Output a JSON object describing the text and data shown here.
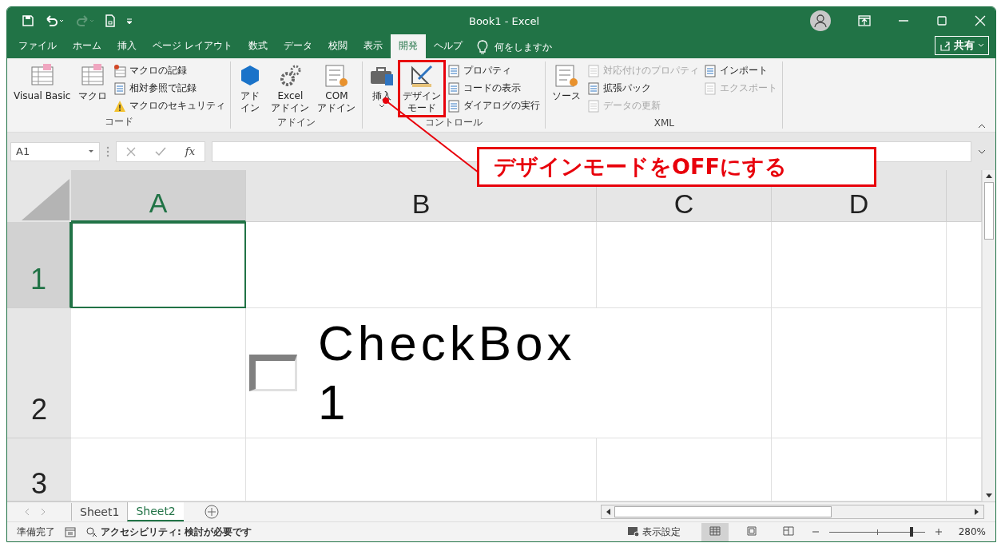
{
  "window": {
    "title": "Book1  -  Excel"
  },
  "share_button": {
    "label": "共有"
  },
  "tabs": [
    {
      "label": "ファイル",
      "selected": false
    },
    {
      "label": "ホーム",
      "selected": false
    },
    {
      "label": "挿入",
      "selected": false
    },
    {
      "label": "ページ レイアウト",
      "selected": false
    },
    {
      "label": "数式",
      "selected": false
    },
    {
      "label": "データ",
      "selected": false
    },
    {
      "label": "校閲",
      "selected": false
    },
    {
      "label": "表示",
      "selected": false
    },
    {
      "label": "開発",
      "selected": true
    },
    {
      "label": "ヘルプ",
      "selected": false
    }
  ],
  "tell_me": {
    "placeholder": "何をしますか"
  },
  "ribbon": {
    "groups": [
      {
        "label": "コード",
        "items": [
          {
            "kind": "large",
            "lines": [
              "Visual Basic"
            ],
            "disabled": false,
            "marked": false
          },
          {
            "kind": "large",
            "lines": [
              "マクロ"
            ],
            "disabled": false,
            "marked": false
          },
          {
            "kind": "small",
            "label": "マクロの記録",
            "disabled": false,
            "marked": false
          },
          {
            "kind": "small",
            "label": "相対参照で記録",
            "disabled": false,
            "marked": false
          },
          {
            "kind": "small",
            "label": "マクロのセキュリティ",
            "disabled": false,
            "marked": false
          }
        ]
      },
      {
        "label": "アドイン",
        "items": [
          {
            "kind": "large",
            "lines": [
              "アド",
              "イン"
            ],
            "disabled": false,
            "marked": false
          },
          {
            "kind": "large",
            "lines": [
              "Excel",
              "アドイン"
            ],
            "disabled": false,
            "marked": false
          },
          {
            "kind": "large",
            "lines": [
              "COM",
              "アドイン"
            ],
            "disabled": false,
            "marked": false
          }
        ]
      },
      {
        "label": "コントロール",
        "items": [
          {
            "kind": "large",
            "lines": [
              "挿入"
            ],
            "disabled": false,
            "marked": false,
            "dropdown": true
          },
          {
            "kind": "large",
            "lines": [
              "デザイン",
              "モード"
            ],
            "disabled": false,
            "marked": true,
            "dropdown": false
          },
          {
            "kind": "small",
            "label": "プロパティ",
            "disabled": false,
            "marked": false
          },
          {
            "kind": "small",
            "label": "コードの表示",
            "disabled": false,
            "marked": false
          },
          {
            "kind": "small",
            "label": "ダイアログの実行",
            "disabled": false,
            "marked": false
          }
        ]
      },
      {
        "label": "XML",
        "items": [
          {
            "kind": "large",
            "lines": [
              "ソース"
            ],
            "disabled": false,
            "marked": false
          },
          {
            "kind": "small",
            "label": "対応付けのプロパティ",
            "disabled": true,
            "marked": false
          },
          {
            "kind": "small",
            "label": "拡張パック",
            "disabled": false,
            "marked": false
          },
          {
            "kind": "small",
            "label": "データの更新",
            "disabled": true,
            "marked": false
          },
          {
            "kind": "small",
            "label": "インポート",
            "disabled": false,
            "marked": false
          },
          {
            "kind": "small",
            "label": "エクスポート",
            "disabled": true,
            "marked": false
          }
        ]
      }
    ]
  },
  "formula_bar": {
    "name_box": "A1",
    "fx": "fx"
  },
  "columns": [
    {
      "label": "A",
      "selected": true
    },
    {
      "label": "B",
      "selected": false
    },
    {
      "label": "C",
      "selected": false
    },
    {
      "label": "D",
      "selected": false
    }
  ],
  "rows": [
    {
      "label": "1",
      "selected": true
    },
    {
      "label": "2",
      "selected": false
    },
    {
      "label": "3",
      "selected": false
    }
  ],
  "checkbox": {
    "label": "CheckBox1",
    "checked": false
  },
  "callout": {
    "text": "デザインモードをOFFにする"
  },
  "sheet_tabs": [
    {
      "label": "Sheet1",
      "selected": false
    },
    {
      "label": "Sheet2",
      "selected": true
    }
  ],
  "status_bar": {
    "ready": "準備完了",
    "accessibility": "アクセシビリティ: 検討が必要です",
    "display_settings": "表示設定",
    "zoom": {
      "level": 0.86,
      "reading": "280%"
    }
  }
}
